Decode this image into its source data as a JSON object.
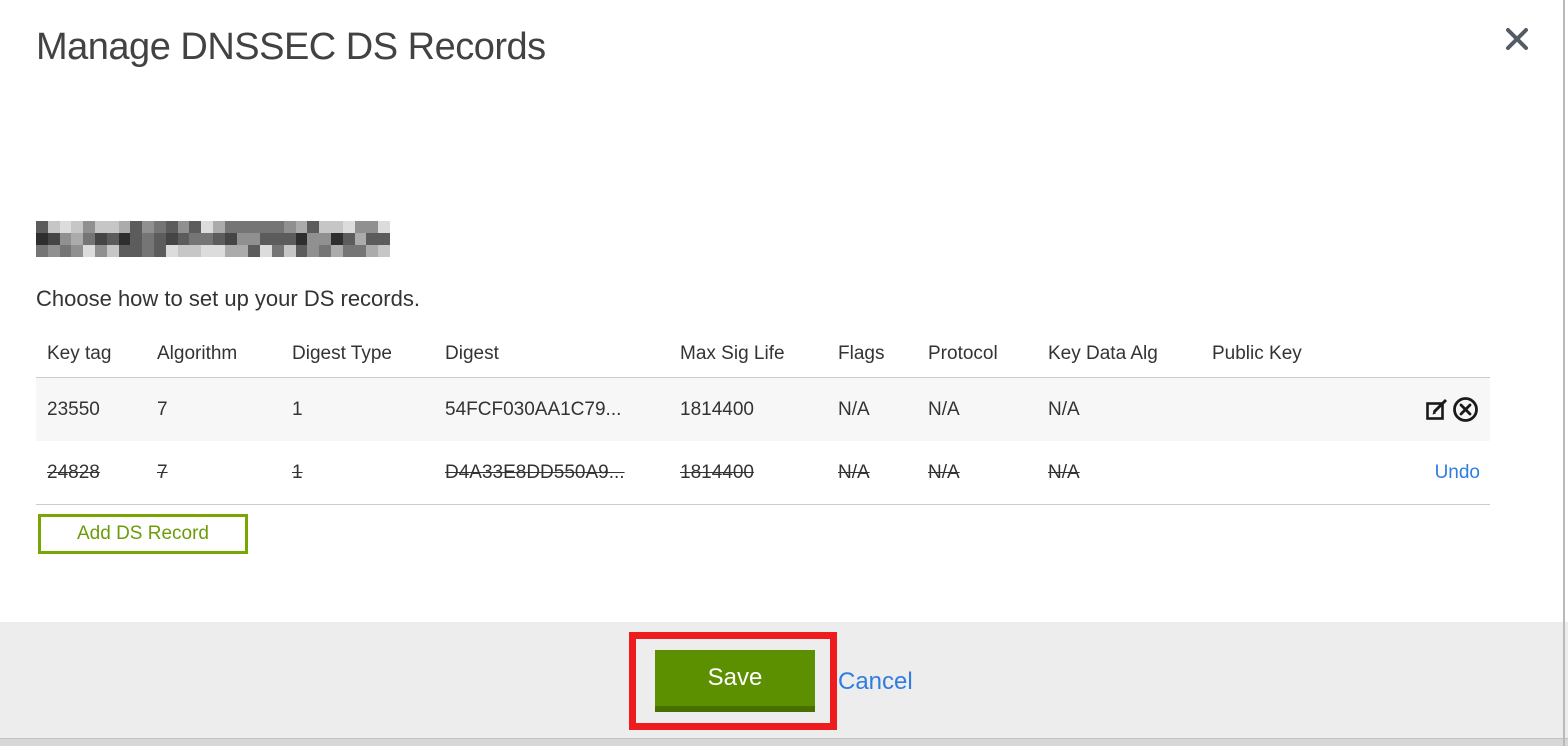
{
  "modal": {
    "title": "Manage DNSSEC DS Records",
    "subtitle": "Choose how to set up your DS records.",
    "domain": {
      "redacted": true
    },
    "table": {
      "columns": [
        "Key tag",
        "Algorithm",
        "Digest Type",
        "Digest",
        "Max Sig Life",
        "Flags",
        "Protocol",
        "Key Data Alg",
        "Public Key"
      ],
      "rows": [
        {
          "state": "active",
          "cells": [
            "23550",
            "7",
            "1",
            "54FCF030AA1C79...",
            "1814400",
            "N/A",
            "N/A",
            "N/A",
            ""
          ],
          "actions": [
            "edit",
            "delete"
          ]
        },
        {
          "state": "deleted",
          "cells": [
            "24828",
            "7",
            "1",
            "D4A33E8DD550A9...",
            "1814400",
            "N/A",
            "N/A",
            "N/A",
            ""
          ],
          "undo_label": "Undo"
        }
      ]
    },
    "add_button_label": "Add DS Record"
  },
  "footer": {
    "save_label": "Save",
    "cancel_label": "Cancel"
  },
  "colors": {
    "save_green": "#5c9000",
    "save_green_dark": "#477000",
    "add_border_green": "#79a602",
    "link_blue": "#2f7de1",
    "annotation_red": "#ee1c1f",
    "row_stripe": "#f7f7f7",
    "footer_gray": "#ededed"
  }
}
